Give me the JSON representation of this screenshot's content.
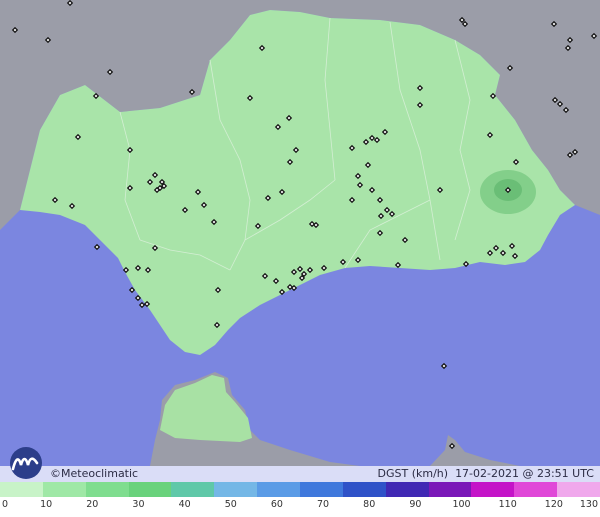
{
  "footer": {
    "credit": "©Meteoclimatic",
    "variable": "DGST (km/h)",
    "datetime": "17-02-2021 @ 23:51 UTC"
  },
  "scale": {
    "labels": [
      "0",
      "10",
      "20",
      "30",
      "40",
      "50",
      "60",
      "70",
      "80",
      "90",
      "100",
      "110",
      "120",
      "130"
    ],
    "colors": [
      "#c8f3c8",
      "#9fe8a6",
      "#7fdd8f",
      "#69d27c",
      "#5fc8a8",
      "#74b7e6",
      "#5a9be6",
      "#3f78dc",
      "#2f52c8",
      "#4028b4",
      "#7a18b8",
      "#c414c8",
      "#e048d8",
      "#f0a8ec"
    ]
  },
  "colors": {
    "sea": "#7b86e0",
    "land_outside": "#9a9ca6",
    "andalusia": "#a9e4a9",
    "station_marker": "#111111"
  },
  "icons": [
    "meteoclimatic-logo",
    "station-marker"
  ]
}
